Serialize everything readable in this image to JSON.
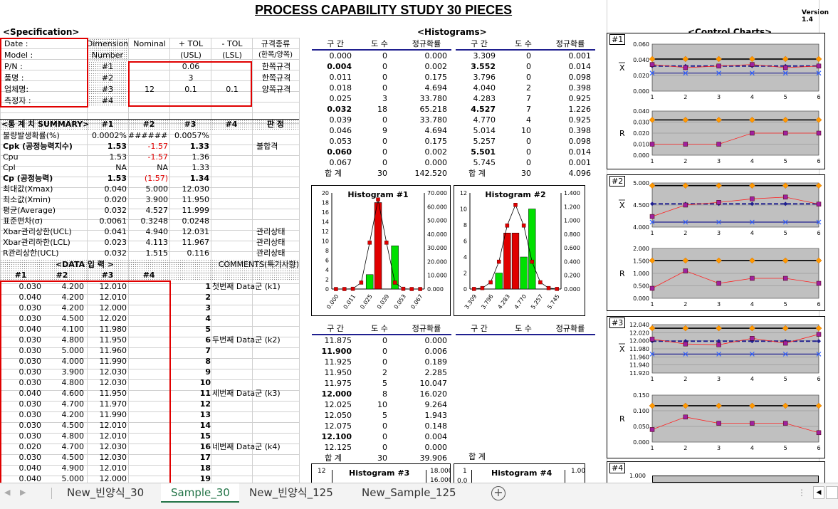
{
  "title": "PROCESS CAPABILITY STUDY 30 PIECES",
  "version": "Version 1.4",
  "spec": {
    "header": "<Specification>",
    "labels": [
      "Date :",
      "Model :",
      "P/N :",
      "품명 :",
      "업체명:",
      "측정자 :"
    ],
    "col_dim": [
      "Dimension",
      "Number"
    ],
    "col_nominal": "Nominal",
    "col_ptol": [
      "+ TOL",
      "(USL)"
    ],
    "col_mtol": [
      "- TOL",
      "(LSL)"
    ],
    "col_type": [
      "규격종류",
      "(한쪽/양쪽)"
    ],
    "rows": [
      {
        "num": "#1",
        "nominal": "",
        "ptol": "0.06",
        "mtol": "",
        "type": "한쪽규격"
      },
      {
        "num": "#2",
        "nominal": "",
        "ptol": "3",
        "mtol": "",
        "type": "한쪽규격"
      },
      {
        "num": "#3",
        "nominal": "12",
        "ptol": "0.1",
        "mtol": "0.1",
        "type": "양쪽규격"
      },
      {
        "num": "#4",
        "nominal": "",
        "ptol": "",
        "mtol": "",
        "type": ""
      }
    ]
  },
  "summary": {
    "header": "<통 계 치 SUMMARY>",
    "cols": [
      "#1",
      "#2",
      "#3",
      "#4",
      "판 정"
    ],
    "rows": [
      {
        "label": "불량발생확률(%)",
        "v": [
          "0.0002%",
          "#######",
          "0.0057%",
          ""
        ],
        "j": ""
      },
      {
        "label": "Cpk (공정능력지수)",
        "v": [
          "1.53",
          "-1.57",
          "1.33",
          ""
        ],
        "j": "불합격",
        "bold": true
      },
      {
        "label": "Cpu",
        "v": [
          "1.53",
          "-1.57",
          "1.36",
          ""
        ],
        "j": ""
      },
      {
        "label": "Cpl",
        "v": [
          "NA",
          "NA",
          "1.33",
          ""
        ],
        "j": ""
      },
      {
        "label": "Cp (공정능력)",
        "v": [
          "1.53",
          "(1.57)",
          "1.34",
          ""
        ],
        "j": "",
        "bold": true
      },
      {
        "label": "최대값(Xmax)",
        "v": [
          "0.040",
          "5.000",
          "12.030",
          ""
        ],
        "j": ""
      },
      {
        "label": "최소값(Xmin)",
        "v": [
          "0.020",
          "3.900",
          "11.950",
          ""
        ],
        "j": ""
      },
      {
        "label": "평균(Average)",
        "v": [
          "0.032",
          "4.527",
          "11.999",
          ""
        ],
        "j": ""
      },
      {
        "label": "표준편차(σ)",
        "v": [
          "0.0061",
          "0.3248",
          "0.0248",
          ""
        ],
        "j": ""
      },
      {
        "label": "Xbar관리상한(UCL)",
        "v": [
          "0.041",
          "4.940",
          "12.031",
          ""
        ],
        "j": "관리상태"
      },
      {
        "label": "Xbar관리하한(LCL)",
        "v": [
          "0.023",
          "4.113",
          "11.967",
          ""
        ],
        "j": "관리상태"
      },
      {
        "label": "R관리상한(UCL)",
        "v": [
          "0.032",
          "1.515",
          "0.116",
          ""
        ],
        "j": "관리상태"
      }
    ]
  },
  "data_input": {
    "header": "<DATA 입 력 >",
    "comments_header": "COMMENTS(특기사항)",
    "cols": [
      "#1",
      "#2",
      "#3",
      "#4"
    ],
    "rows": [
      [
        "0.030",
        "4.200",
        "12.010",
        "",
        "1",
        "첫번째 Data군 (k1)"
      ],
      [
        "0.040",
        "4.200",
        "12.010",
        "",
        "2",
        ""
      ],
      [
        "0.030",
        "4.200",
        "12.000",
        "",
        "3",
        ""
      ],
      [
        "0.030",
        "4.500",
        "12.020",
        "",
        "4",
        ""
      ],
      [
        "0.040",
        "4.100",
        "11.980",
        "",
        "5",
        ""
      ],
      [
        "0.030",
        "4.800",
        "11.950",
        "",
        "6",
        "두번째 Data군 (k2)"
      ],
      [
        "0.030",
        "5.000",
        "11.960",
        "",
        "7",
        ""
      ],
      [
        "0.030",
        "4.000",
        "11.990",
        "",
        "8",
        ""
      ],
      [
        "0.030",
        "3.900",
        "12.030",
        "",
        "9",
        ""
      ],
      [
        "0.030",
        "4.800",
        "12.030",
        "",
        "10",
        ""
      ],
      [
        "0.040",
        "4.600",
        "11.950",
        "",
        "11",
        "세번째 Data군 (k3)"
      ],
      [
        "0.030",
        "4.700",
        "11.970",
        "",
        "12",
        ""
      ],
      [
        "0.030",
        "4.200",
        "11.990",
        "",
        "13",
        ""
      ],
      [
        "0.030",
        "4.500",
        "12.010",
        "",
        "14",
        ""
      ],
      [
        "0.030",
        "4.800",
        "12.010",
        "",
        "15",
        ""
      ],
      [
        "0.020",
        "4.700",
        "12.030",
        "",
        "16",
        "네번째 Data군 (k4)"
      ],
      [
        "0.030",
        "4.500",
        "12.030",
        "",
        "17",
        ""
      ],
      [
        "0.040",
        "4.900",
        "12.010",
        "",
        "18",
        ""
      ],
      [
        "0.040",
        "5.000",
        "12.000",
        "",
        "19",
        ""
      ]
    ]
  },
  "histograms": {
    "header": "<Histograms>",
    "col_labels": [
      "구 간",
      "도 수",
      "정규확률"
    ],
    "table1": [
      [
        "0.000",
        "0",
        "0.000"
      ],
      [
        "0.004",
        "0",
        "0.002"
      ],
      [
        "0.011",
        "0",
        "0.175"
      ],
      [
        "0.018",
        "0",
        "4.694"
      ],
      [
        "0.025",
        "3",
        "33.780"
      ],
      [
        "0.032",
        "18",
        "65.218"
      ],
      [
        "0.039",
        "0",
        "33.780"
      ],
      [
        "0.046",
        "9",
        "4.694"
      ],
      [
        "0.053",
        "0",
        "0.175"
      ],
      [
        "0.060",
        "0",
        "0.002"
      ],
      [
        "0.067",
        "0",
        "0.000"
      ]
    ],
    "table1_bold": [
      1,
      5,
      9
    ],
    "table1_total": [
      "합 계",
      "30",
      "142.520"
    ],
    "table2": [
      [
        "3.309",
        "0",
        "0.001"
      ],
      [
        "3.552",
        "0",
        "0.014"
      ],
      [
        "3.796",
        "0",
        "0.098"
      ],
      [
        "4.040",
        "2",
        "0.398"
      ],
      [
        "4.283",
        "7",
        "0.925"
      ],
      [
        "4.527",
        "7",
        "1.226"
      ],
      [
        "4.770",
        "4",
        "0.925"
      ],
      [
        "5.014",
        "10",
        "0.398"
      ],
      [
        "5.257",
        "0",
        "0.098"
      ],
      [
        "5.501",
        "0",
        "0.014"
      ],
      [
        "5.745",
        "0",
        "0.001"
      ]
    ],
    "table2_bold": [
      1,
      5,
      9
    ],
    "table2_total": [
      "합 계",
      "30",
      "4.096"
    ],
    "table3": [
      [
        "11.875",
        "0",
        "0.000"
      ],
      [
        "11.900",
        "0",
        "0.006"
      ],
      [
        "11.925",
        "0",
        "0.189"
      ],
      [
        "11.950",
        "2",
        "2.285"
      ],
      [
        "11.975",
        "5",
        "10.047"
      ],
      [
        "12.000",
        "8",
        "16.020"
      ],
      [
        "12.025",
        "10",
        "9.264"
      ],
      [
        "12.050",
        "5",
        "1.943"
      ],
      [
        "12.075",
        "0",
        "0.148"
      ],
      [
        "12.100",
        "0",
        "0.004"
      ],
      [
        "12.125",
        "0",
        "0.000"
      ]
    ],
    "table3_bold": [
      1,
      5,
      9
    ],
    "table3_total": [
      "합 계",
      "30",
      "39.906"
    ],
    "table4_total": [
      "합 계"
    ]
  },
  "chart_data": [
    {
      "type": "bar",
      "title": "Histogram #1",
      "categories": [
        "0.000",
        "0.004",
        "0.011",
        "0.018",
        "0.025",
        "0.032",
        "0.039",
        "0.046",
        "0.053",
        "0.060",
        "0.067"
      ],
      "series": [
        {
          "name": "도 수",
          "values": [
            0,
            0,
            0,
            0,
            3,
            18,
            0,
            9,
            0,
            0,
            0
          ]
        },
        {
          "name": "정규확률",
          "values": [
            0,
            0.002,
            0.175,
            4.694,
            33.78,
            65.218,
            33.78,
            4.694,
            0.175,
            0.002,
            0
          ]
        }
      ],
      "xtick_labels": [
        "0.000",
        "0.011",
        "0.025",
        "0.039",
        "0.053",
        "0.067"
      ],
      "ylim": [
        0,
        20
      ],
      "y_ticks": [
        "0",
        "2",
        "4",
        "6",
        "8",
        "10",
        "12",
        "14",
        "16",
        "18",
        "20"
      ],
      "y2lim": [
        0,
        70
      ],
      "y2_ticks": [
        "0.000",
        "10.000",
        "20.000",
        "30.000",
        "40.000",
        "50.000",
        "60.000",
        "70.000"
      ]
    },
    {
      "type": "bar",
      "title": "Histogram #2",
      "categories": [
        "3.309",
        "3.552",
        "3.796",
        "4.040",
        "4.283",
        "4.527",
        "4.770",
        "5.014",
        "5.257",
        "5.501",
        "5.745"
      ],
      "series": [
        {
          "name": "도 수",
          "values": [
            0,
            0,
            0,
            2,
            7,
            7,
            4,
            10,
            0,
            0,
            0
          ]
        },
        {
          "name": "정규확률",
          "values": [
            0.001,
            0.014,
            0.098,
            0.398,
            0.925,
            1.226,
            0.925,
            0.398,
            0.098,
            0.014,
            0.001
          ]
        }
      ],
      "xtick_labels": [
        "3.309",
        "3.796",
        "4.283",
        "4.770",
        "5.257",
        "5.745"
      ],
      "ylim": [
        0,
        12
      ],
      "y_ticks": [
        "0",
        "2",
        "4",
        "6",
        "8",
        "10",
        "12"
      ],
      "y2lim": [
        0,
        1.4
      ],
      "y2_ticks": [
        "0.000",
        "0.200",
        "0.400",
        "0.600",
        "0.800",
        "1.000",
        "1.200",
        "1.400"
      ]
    },
    {
      "type": "line",
      "title": "Control Chart #1 Xbar",
      "x": [
        1,
        2,
        3,
        4,
        5,
        6
      ],
      "ylim": [
        0,
        0.06
      ],
      "y_ticks": [
        "0.000",
        "0.020",
        "0.040",
        "0.060"
      ],
      "series": [
        {
          "name": "UCL",
          "values": [
            0.041,
            0.041,
            0.041,
            0.041,
            0.041,
            0.041
          ]
        },
        {
          "name": "CL",
          "values": [
            0.032,
            0.032,
            0.032,
            0.032,
            0.032,
            0.032
          ]
        },
        {
          "name": "LCL",
          "values": [
            0.023,
            0.023,
            0.023,
            0.023,
            0.023,
            0.023
          ]
        },
        {
          "name": "Xbar",
          "values": [
            0.034,
            0.03,
            0.032,
            0.034,
            0.03,
            0.032
          ]
        }
      ]
    },
    {
      "type": "line",
      "title": "Control Chart #1 R",
      "x": [
        1,
        2,
        3,
        4,
        5,
        6
      ],
      "ylim": [
        0,
        0.04
      ],
      "y_ticks": [
        "0.000",
        "0.010",
        "0.020",
        "0.030",
        "0.040"
      ],
      "series": [
        {
          "name": "UCL",
          "values": [
            0.032,
            0.032,
            0.032,
            0.032,
            0.032,
            0.032
          ]
        },
        {
          "name": "R",
          "values": [
            0.01,
            0.01,
            0.01,
            0.02,
            0.02,
            0.02
          ]
        }
      ]
    },
    {
      "type": "line",
      "title": "Control Chart #2 Xbar",
      "x": [
        1,
        2,
        3,
        4,
        5,
        6
      ],
      "ylim": [
        4.0,
        5.0
      ],
      "y_ticks": [
        "4.000",
        "4.500",
        "5.000"
      ],
      "series": [
        {
          "name": "UCL",
          "values": [
            4.94,
            4.94,
            4.94,
            4.94,
            4.94,
            4.94
          ]
        },
        {
          "name": "CL",
          "values": [
            4.527,
            4.527,
            4.527,
            4.527,
            4.527,
            4.527
          ]
        },
        {
          "name": "LCL",
          "values": [
            4.113,
            4.113,
            4.113,
            4.113,
            4.113,
            4.113
          ]
        },
        {
          "name": "Xbar",
          "values": [
            4.24,
            4.5,
            4.56,
            4.64,
            4.68,
            4.52
          ]
        }
      ]
    },
    {
      "type": "line",
      "title": "Control Chart #2 R",
      "x": [
        1,
        2,
        3,
        4,
        5,
        6
      ],
      "ylim": [
        0,
        2.0
      ],
      "y_ticks": [
        "0.000",
        "0.500",
        "1.000",
        "1.500",
        "2.000"
      ],
      "series": [
        {
          "name": "UCL",
          "values": [
            1.515,
            1.515,
            1.515,
            1.515,
            1.515,
            1.515
          ]
        },
        {
          "name": "R",
          "values": [
            0.4,
            1.1,
            0.6,
            0.8,
            0.8,
            0.6
          ]
        }
      ]
    },
    {
      "type": "line",
      "title": "Control Chart #3 Xbar",
      "x": [
        1,
        2,
        3,
        4,
        5,
        6
      ],
      "ylim": [
        11.92,
        12.04
      ],
      "y_ticks": [
        "11.920",
        "11.940",
        "11.960",
        "11.980",
        "12.000",
        "12.020",
        "12.040"
      ],
      "series": [
        {
          "name": "UCL",
          "values": [
            12.031,
            12.031,
            12.031,
            12.031,
            12.031,
            12.031
          ]
        },
        {
          "name": "CL",
          "values": [
            11.999,
            11.999,
            11.999,
            11.999,
            11.999,
            11.999
          ]
        },
        {
          "name": "LCL",
          "values": [
            11.967,
            11.967,
            11.967,
            11.967,
            11.967,
            11.967
          ]
        },
        {
          "name": "Xbar",
          "values": [
            12.004,
            11.992,
            11.99,
            12.006,
            11.994,
            12.016
          ]
        }
      ]
    },
    {
      "type": "line",
      "title": "Control Chart #3 R",
      "x": [
        1,
        2,
        3,
        4,
        5,
        6
      ],
      "ylim": [
        0,
        0.15
      ],
      "y_ticks": [
        "0.000",
        "0.050",
        "0.100",
        "0.150"
      ],
      "series": [
        {
          "name": "UCL",
          "values": [
            0.116,
            0.116,
            0.116,
            0.116,
            0.116,
            0.116
          ]
        },
        {
          "name": "R",
          "values": [
            0.04,
            0.08,
            0.06,
            0.06,
            0.06,
            0.03
          ]
        }
      ]
    }
  ],
  "hist3_title": "Histogram #3",
  "hist3_ytop": "12",
  "hist3_y2top": "18.000",
  "hist3_y2next": "16.000",
  "hist4_title": "Histogram #4",
  "hist4_ytop": "1",
  "hist4_y2top": "1.00",
  "hist4_xleft": "0.0",
  "control": {
    "header": "<Control Charts>",
    "labels": [
      "#1",
      "#2",
      "#3",
      "#4"
    ],
    "xbar_label": "X",
    "r_label": "R",
    "cc4_ytop": "1.000"
  },
  "tabs": [
    "New_빈양식_30",
    "Sample_30",
    "New_빈양식_125",
    "New_Sample_125"
  ],
  "active_tab": 1,
  "colors": {
    "accent": "#217346",
    "red": "#e00000",
    "green": "#00e000",
    "navy": "#1f1f8f",
    "orange": "#ff9900"
  }
}
